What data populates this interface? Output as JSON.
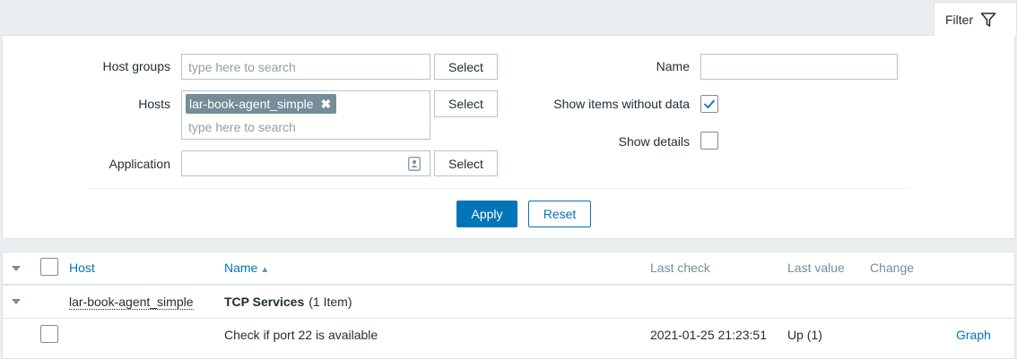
{
  "filter_tab": {
    "label": "Filter",
    "icon": "funnel-icon"
  },
  "filter": {
    "host_groups": {
      "label": "Host groups",
      "placeholder": "type here to search",
      "select_label": "Select"
    },
    "hosts": {
      "label": "Hosts",
      "chips": [
        "lar-book-agent_simple"
      ],
      "chip_remove": "✖",
      "placeholder": "type here to search",
      "select_label": "Select"
    },
    "application": {
      "label": "Application",
      "value": "",
      "select_label": "Select"
    },
    "name": {
      "label": "Name",
      "value": ""
    },
    "show_items_without_data": {
      "label": "Show items without data",
      "checked": true
    },
    "show_details": {
      "label": "Show details",
      "checked": false
    },
    "apply_label": "Apply",
    "reset_label": "Reset"
  },
  "table": {
    "columns": {
      "host": "Host",
      "name": "Name",
      "name_sort": "▲",
      "last_check": "Last check",
      "last_value": "Last value",
      "change": "Change"
    },
    "group": {
      "host": "lar-book-agent_simple",
      "app_name": "TCP Services",
      "app_count": "(1 Item)"
    },
    "rows": [
      {
        "name": "Check if port 22 is available",
        "last_check": "2021-01-25 21:23:51",
        "last_value": "Up (1)",
        "change": "",
        "action": "Graph"
      }
    ]
  },
  "colors": {
    "accent": "#0275b8",
    "chip": "#768d99",
    "background": "#ebeef0"
  }
}
